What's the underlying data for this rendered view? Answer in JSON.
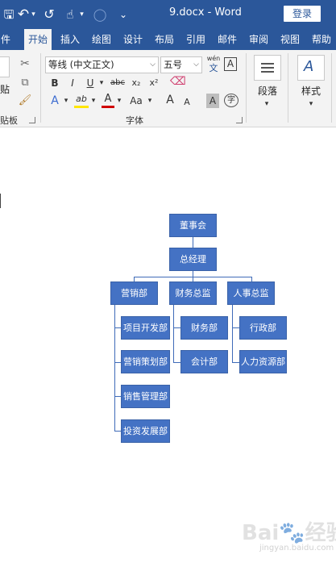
{
  "titlebar": {
    "document_title": "9.docx  -  Word",
    "login_label": "登录",
    "qat": {
      "save_glyph": "🖫",
      "undo_glyph": "↶",
      "undo_menu_glyph": "▾",
      "redo_glyph": "↺",
      "touch_glyph": "☝",
      "touch_menu_glyph": "▾",
      "circle_glyph": "◯",
      "customize_glyph": "⌄"
    }
  },
  "tabs": [
    {
      "label": "件"
    },
    {
      "label": "开始"
    },
    {
      "label": "插入"
    },
    {
      "label": "绘图"
    },
    {
      "label": "设计"
    },
    {
      "label": "布局"
    },
    {
      "label": "引用"
    },
    {
      "label": "邮件"
    },
    {
      "label": "审阅"
    },
    {
      "label": "视图"
    },
    {
      "label": "帮助"
    }
  ],
  "ribbon": {
    "clipboard": {
      "paste_label": "贴",
      "group_label": "贴板"
    },
    "font": {
      "font_name": "等线 (中文正文)",
      "font_size": "五号",
      "phonetic_top": "wén",
      "phonetic_bottom": "文",
      "border_char": "A",
      "bold": "B",
      "italic": "I",
      "underline": "U",
      "strike": "abc",
      "subscript": "x₂",
      "superscript": "x²",
      "text_effect": "A",
      "highlight": "ab",
      "font_color": "A",
      "change_case": "Aa",
      "grow": "A",
      "shrink": "A",
      "shading_char": "A",
      "enclose_char": "字",
      "group_label": "字体"
    },
    "paragraph": {
      "label": "段落"
    },
    "styles": {
      "label": "样式"
    }
  },
  "org_chart": {
    "board": "董事会",
    "gm": "总经理",
    "departments": [
      {
        "name": "营销部",
        "children": [
          "项目开发部",
          "营销策划部",
          "销售管理部",
          "投资发展部"
        ]
      },
      {
        "name": "财务总监",
        "children": [
          "财务部",
          "会计部"
        ]
      },
      {
        "name": "人事总监",
        "children": [
          "行政部",
          "人力资源部"
        ]
      }
    ]
  },
  "watermark": {
    "text": "Bai🐾经验",
    "sub": "jingyan.baidu.com"
  },
  "colors": {
    "word_blue": "#2b579a",
    "node_blue": "#4472c4",
    "ribbon_bg": "#f3f3f3"
  }
}
